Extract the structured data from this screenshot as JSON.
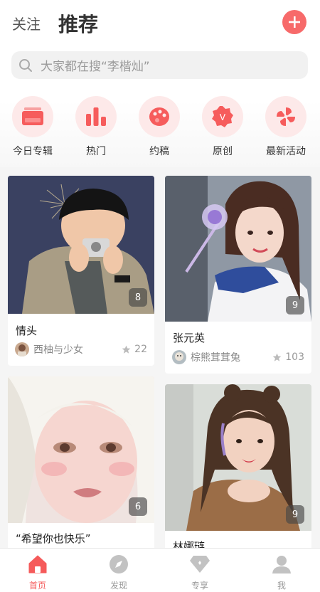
{
  "header": {
    "follow_tab": "关注",
    "recommend_tab": "推荐"
  },
  "search": {
    "placeholder": "大家都在搜“李楷灿”"
  },
  "categories": [
    {
      "label": "今日专辑",
      "icon": "album-icon"
    },
    {
      "label": "热门",
      "icon": "bar-chart-icon"
    },
    {
      "label": "约稿",
      "icon": "palette-icon"
    },
    {
      "label": "原创",
      "icon": "original-v-badge-icon"
    },
    {
      "label": "最新活动",
      "icon": "pinwheel-icon"
    }
  ],
  "cards": [
    {
      "title": "情头",
      "author": "西柚与少女",
      "count": "8",
      "stars": "22"
    },
    {
      "title": "张元英",
      "author": "棕熊茸茸兔",
      "count": "9",
      "stars": "103"
    },
    {
      "title": "“希望你也快乐”",
      "count": "6"
    },
    {
      "title": "林娜琏",
      "count": "9"
    }
  ],
  "tabbar": [
    {
      "label": "首页",
      "icon": "home-icon",
      "active": true
    },
    {
      "label": "发现",
      "icon": "compass-icon"
    },
    {
      "label": "专享",
      "icon": "diamond-icon"
    },
    {
      "label": "我",
      "icon": "user-icon"
    }
  ],
  "colors": {
    "accent": "#f55a5a",
    "category_bg": "#fde9e9"
  }
}
